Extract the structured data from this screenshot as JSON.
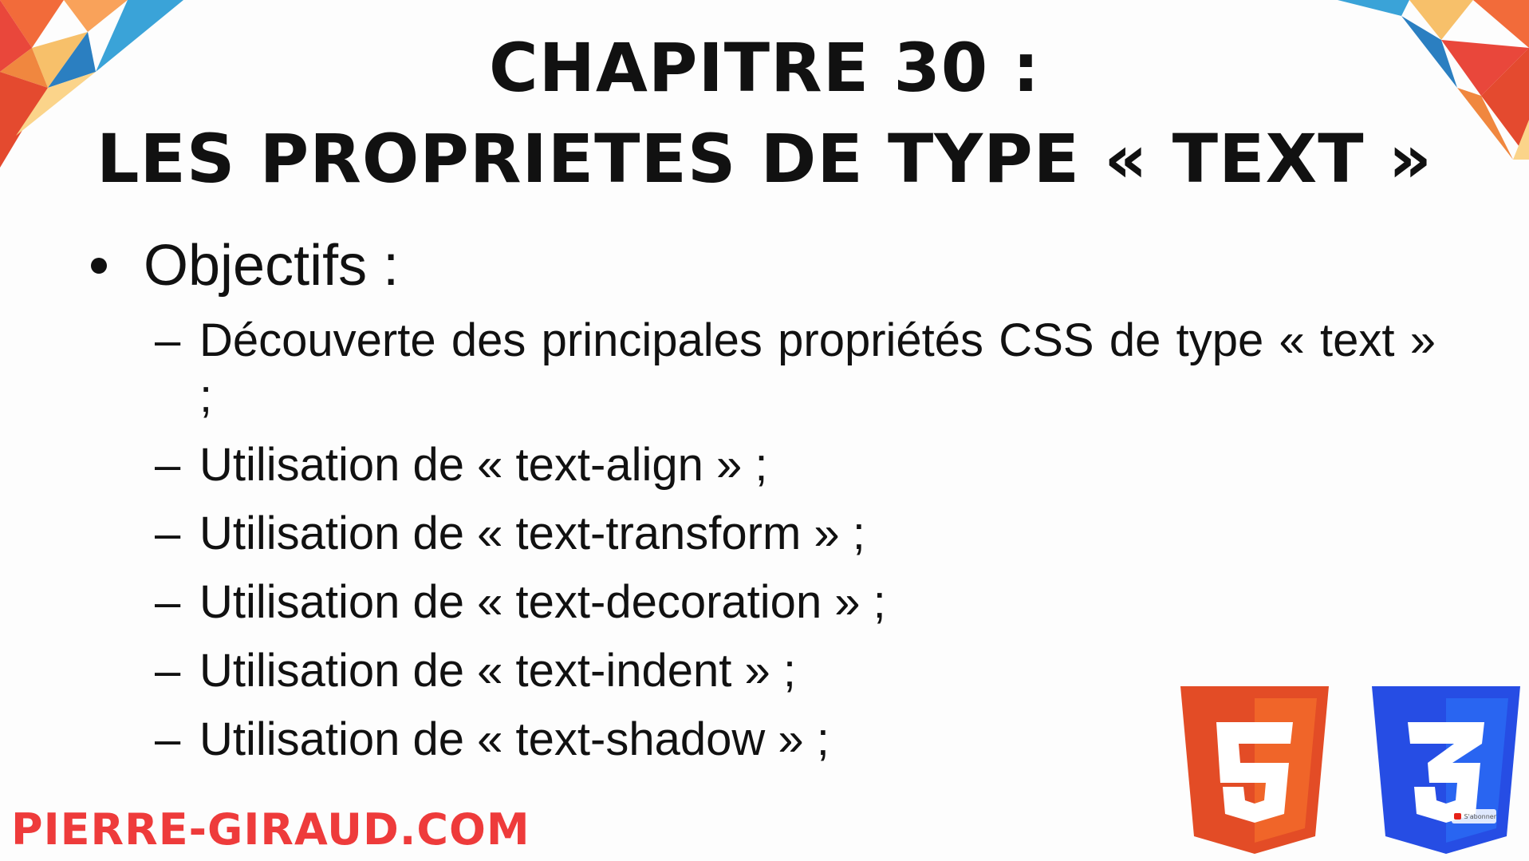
{
  "title": {
    "line1": "CHAPITRE 30 :",
    "line2": "LES PROPRIETES DE TYPE « TEXT »"
  },
  "content": {
    "bullet_label": "Objectifs :",
    "items": [
      "Découverte des principales propriétés CSS de type « text » ;",
      "Utilisation de « text-align » ;",
      "Utilisation de « text-transform » ;",
      "Utilisation de « text-decoration » ;",
      "Utilisation de « text-indent » ;",
      "Utilisation de « text-shadow » ;"
    ]
  },
  "footer": {
    "brand": "PIERRE-GIRAUD.COM"
  },
  "logos": {
    "html5_icon": "html5-logo",
    "css3_icon": "css3-logo"
  },
  "subscribe": {
    "label": "S'abonner"
  },
  "colors": {
    "brand_red": "#ee3b3b",
    "html5_orange": "#e34c26",
    "css3_blue": "#264de4"
  }
}
